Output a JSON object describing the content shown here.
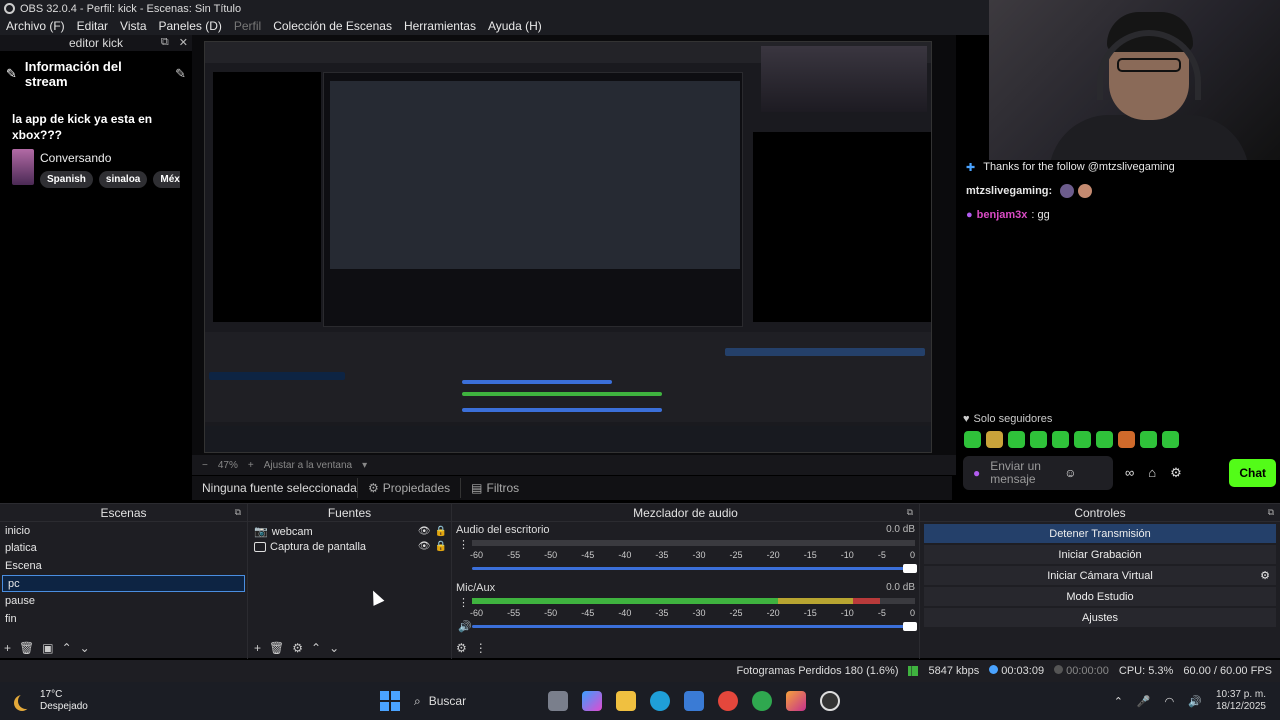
{
  "window": {
    "title": "OBS 32.0.4 - Perfil: kick - Escenas: Sin Título"
  },
  "menu": [
    "Archivo (F)",
    "Editar",
    "Vista",
    "Paneles (D)",
    "Perfil",
    "Colección de Escenas",
    "Herramientas",
    "Ayuda (H)"
  ],
  "left_dock": {
    "header": "editor kick",
    "section_title": "Información del stream",
    "stream_title": "la app de kick ya esta en xbox???",
    "category": "Conversando",
    "tags": [
      "Spanish",
      "sinaloa",
      "Méx"
    ]
  },
  "chat": {
    "lines": [
      {
        "name": "",
        "text": "Thanks for the follow @mtzslivegaming"
      },
      {
        "name": "mtzslivegaming:",
        "text": ""
      },
      {
        "name": "benjam3x",
        "text": ": gg"
      }
    ],
    "followers_label": "Solo seguidores",
    "input_placeholder": "Enviar un mensaje",
    "send_button": "Chat"
  },
  "preview": {
    "zoom": "47%",
    "fit_label": "Ajustar a la ventana"
  },
  "source_bar": {
    "none_selected": "Ninguna fuente seleccionada",
    "properties": "Propiedades",
    "filters": "Filtros"
  },
  "scenes": {
    "title": "Escenas",
    "items": [
      "inicio",
      "platica",
      "Escena",
      "pc",
      "pause",
      "fin"
    ],
    "selected_index": 3
  },
  "sources": {
    "title": "Fuentes",
    "items": [
      {
        "name": "webcam",
        "icon": "camera-icon"
      },
      {
        "name": "Captura de pantalla",
        "icon": "monitor-icon"
      }
    ]
  },
  "mixer": {
    "title": "Mezclador de audio",
    "ticks": [
      "-60",
      "-55",
      "-50",
      "-45",
      "-40",
      "-35",
      "-30",
      "-25",
      "-20",
      "-15",
      "-10",
      "-5",
      "0"
    ],
    "channels": [
      {
        "name": "Audio del escritorio",
        "db": "0.0 dB",
        "level": 0
      },
      {
        "name": "Mic/Aux",
        "db": "0.0 dB",
        "level": 0.92
      }
    ]
  },
  "controls": {
    "title": "Controles",
    "buttons": [
      "Detener Transmisión",
      "Iniciar Grabación",
      "Iniciar Cámara Virtual",
      "Modo Estudio",
      "Ajustes"
    ]
  },
  "status": {
    "dropped": "Fotogramas Perdidos 180 (1.6%)",
    "bitrate": "5847 kbps",
    "stream_time": "00:03:09",
    "rec_time": "00:00:00",
    "cpu": "CPU: 5.3%",
    "fps": "60.00 / 60.00 FPS"
  },
  "taskbar": {
    "temp": "17°C",
    "weather": "Despejado",
    "search": "Buscar",
    "time": "10:37 p. m.",
    "date": "18/12/2025"
  },
  "colors": {
    "kick_green": "#53fc18",
    "accent_blue": "#3b6fd9",
    "selected_bg": "#0d2443"
  }
}
